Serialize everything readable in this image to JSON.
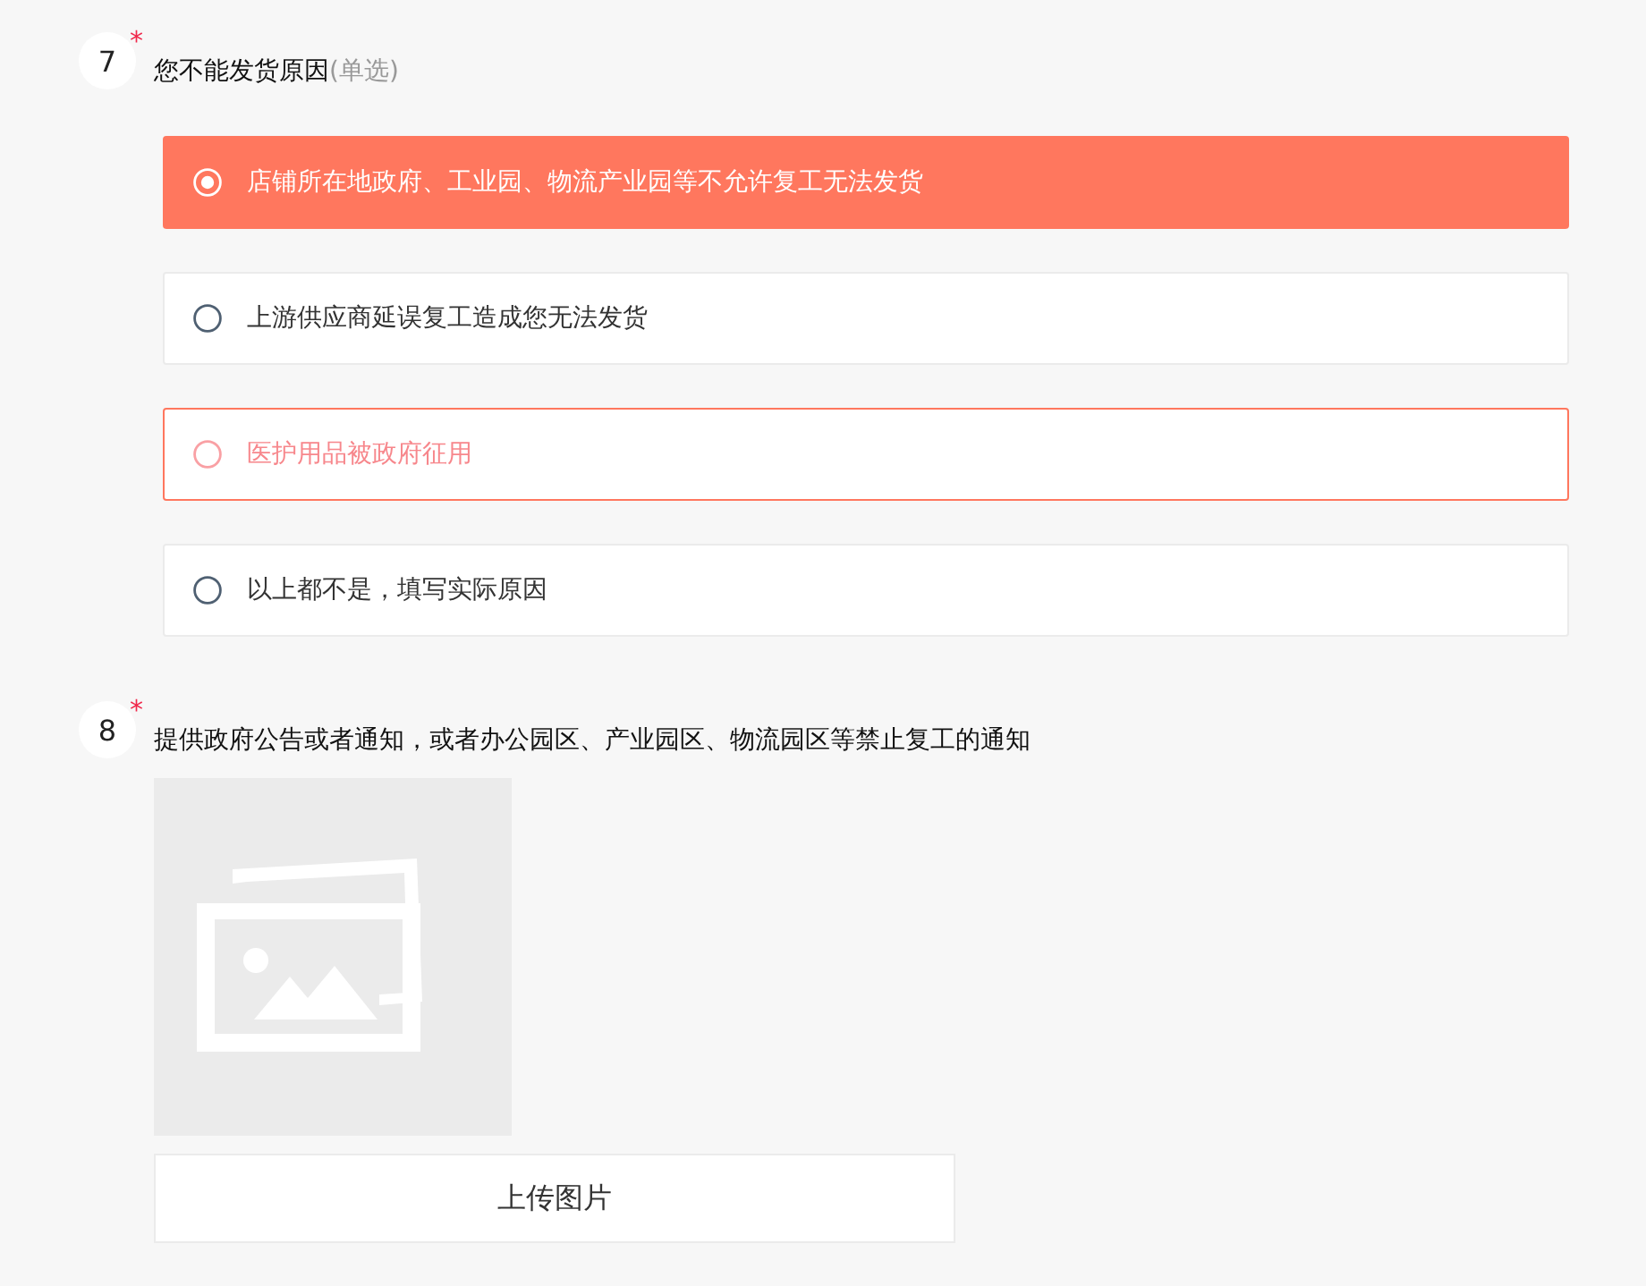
{
  "questions": [
    {
      "number": "7",
      "required_mark": "*",
      "title": "您不能发货原因",
      "hint": "(单选)",
      "kind": "single_choice",
      "options": [
        {
          "label": "店铺所在地政府、工业园、物流产业园等不允许复工无法发货",
          "selected": true,
          "hovered": false
        },
        {
          "label": "上游供应商延误复工造成您无法发货",
          "selected": false,
          "hovered": false
        },
        {
          "label": "医护用品被政府征用",
          "selected": false,
          "hovered": true
        },
        {
          "label": "以上都不是，填写实际原因",
          "selected": false,
          "hovered": false
        }
      ]
    },
    {
      "number": "8",
      "required_mark": "*",
      "title": "提供政府公告或者通知，或者办公园区、产业园区、物流园区等禁止复工的通知",
      "kind": "upload",
      "button": "上传图片"
    }
  ]
}
